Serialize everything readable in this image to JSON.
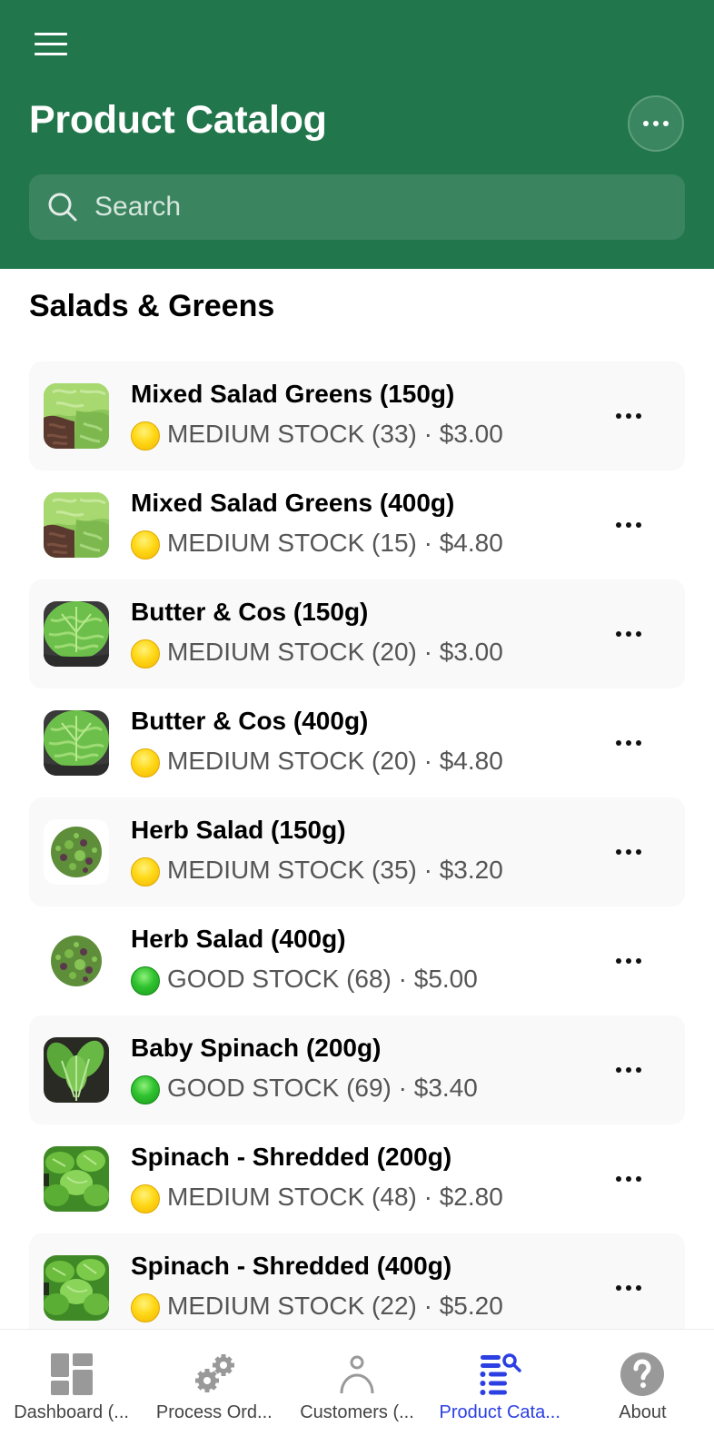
{
  "header": {
    "title": "Product Catalog",
    "menu_icon": "hamburger-icon",
    "more_icon": "ellipsis-icon",
    "search": {
      "placeholder": "Search",
      "value": "",
      "icon": "search-icon"
    },
    "color": "#22764b"
  },
  "section": {
    "title": "Salads & Greens"
  },
  "products": [
    {
      "name": "Mixed Salad Greens (150g)",
      "stock_status": "medium",
      "stock_label": "MEDIUM STOCK (33) · $3.00",
      "stock_count": 33,
      "price": "$3.00",
      "image": "mixed-greens"
    },
    {
      "name": "Mixed Salad Greens (400g)",
      "stock_status": "medium",
      "stock_label": "MEDIUM STOCK (15) · $4.80",
      "stock_count": 15,
      "price": "$4.80",
      "image": "mixed-greens"
    },
    {
      "name": "Butter & Cos (150g)",
      "stock_status": "medium",
      "stock_label": "MEDIUM STOCK (20) · $3.00",
      "stock_count": 20,
      "price": "$3.00",
      "image": "butter-cos"
    },
    {
      "name": "Butter & Cos (400g)",
      "stock_status": "medium",
      "stock_label": "MEDIUM STOCK (20) · $4.80",
      "stock_count": 20,
      "price": "$4.80",
      "image": "butter-cos"
    },
    {
      "name": "Herb Salad (150g)",
      "stock_status": "medium",
      "stock_label": "MEDIUM STOCK (35) · $3.20",
      "stock_count": 35,
      "price": "$3.20",
      "image": "herb-salad"
    },
    {
      "name": "Herb Salad (400g)",
      "stock_status": "good",
      "stock_label": "GOOD STOCK (68) · $5.00",
      "stock_count": 68,
      "price": "$5.00",
      "image": "herb-salad"
    },
    {
      "name": "Baby Spinach (200g)",
      "stock_status": "good",
      "stock_label": "GOOD STOCK (69) · $3.40",
      "stock_count": 69,
      "price": "$3.40",
      "image": "baby-spinach"
    },
    {
      "name": "Spinach - Shredded (200g)",
      "stock_status": "medium",
      "stock_label": "MEDIUM STOCK (48) · $2.80",
      "stock_count": 48,
      "price": "$2.80",
      "image": "spinach-shredded"
    },
    {
      "name": "Spinach - Shredded (400g)",
      "stock_status": "medium",
      "stock_label": "MEDIUM STOCK (22) · $5.20",
      "stock_count": 22,
      "price": "$5.20",
      "image": "spinach-shredded"
    }
  ],
  "status_colors": {
    "medium": "#ffd817",
    "good": "#2fc22f"
  },
  "tabs": [
    {
      "label": "Dashboard (...",
      "icon": "dashboard-icon",
      "active": false
    },
    {
      "label": "Process Ord...",
      "icon": "gears-icon",
      "active": false
    },
    {
      "label": "Customers (...",
      "icon": "person-icon",
      "active": false
    },
    {
      "label": "Product Cata...",
      "icon": "list-search-icon",
      "active": true
    },
    {
      "label": "About",
      "icon": "help-circle-icon",
      "active": false
    }
  ],
  "tab_colors": {
    "active": "#2b3fe3",
    "inactive": "#999999"
  }
}
